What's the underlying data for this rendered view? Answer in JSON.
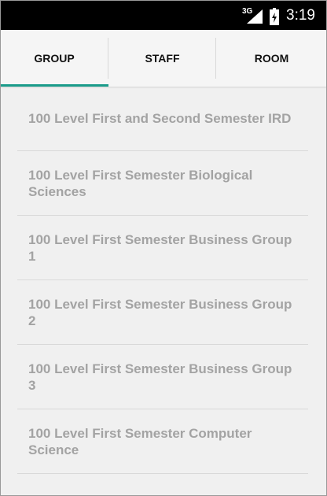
{
  "status_bar": {
    "network": "3G",
    "time": "3:19",
    "icons": [
      "signal-icon",
      "battery-icon"
    ]
  },
  "tabs": [
    {
      "label": "GROUP",
      "selected": true
    },
    {
      "label": "STAFF",
      "selected": false
    },
    {
      "label": "ROOM",
      "selected": false
    }
  ],
  "colors": {
    "accent": "#1a9b8a",
    "status_bar": "#000000",
    "background": "#f0f0f0",
    "item_text": "#a3a3a3"
  },
  "groups": [
    {
      "label": "100 Level First and Second Semester IRD"
    },
    {
      "label": "100 Level First Semester Biological Sciences"
    },
    {
      "label": "100 Level First Semester Business Group 1"
    },
    {
      "label": "100 Level First Semester Business Group 2"
    },
    {
      "label": "100 Level First Semester Business Group 3"
    },
    {
      "label": "100 Level First Semester Computer Science"
    }
  ]
}
